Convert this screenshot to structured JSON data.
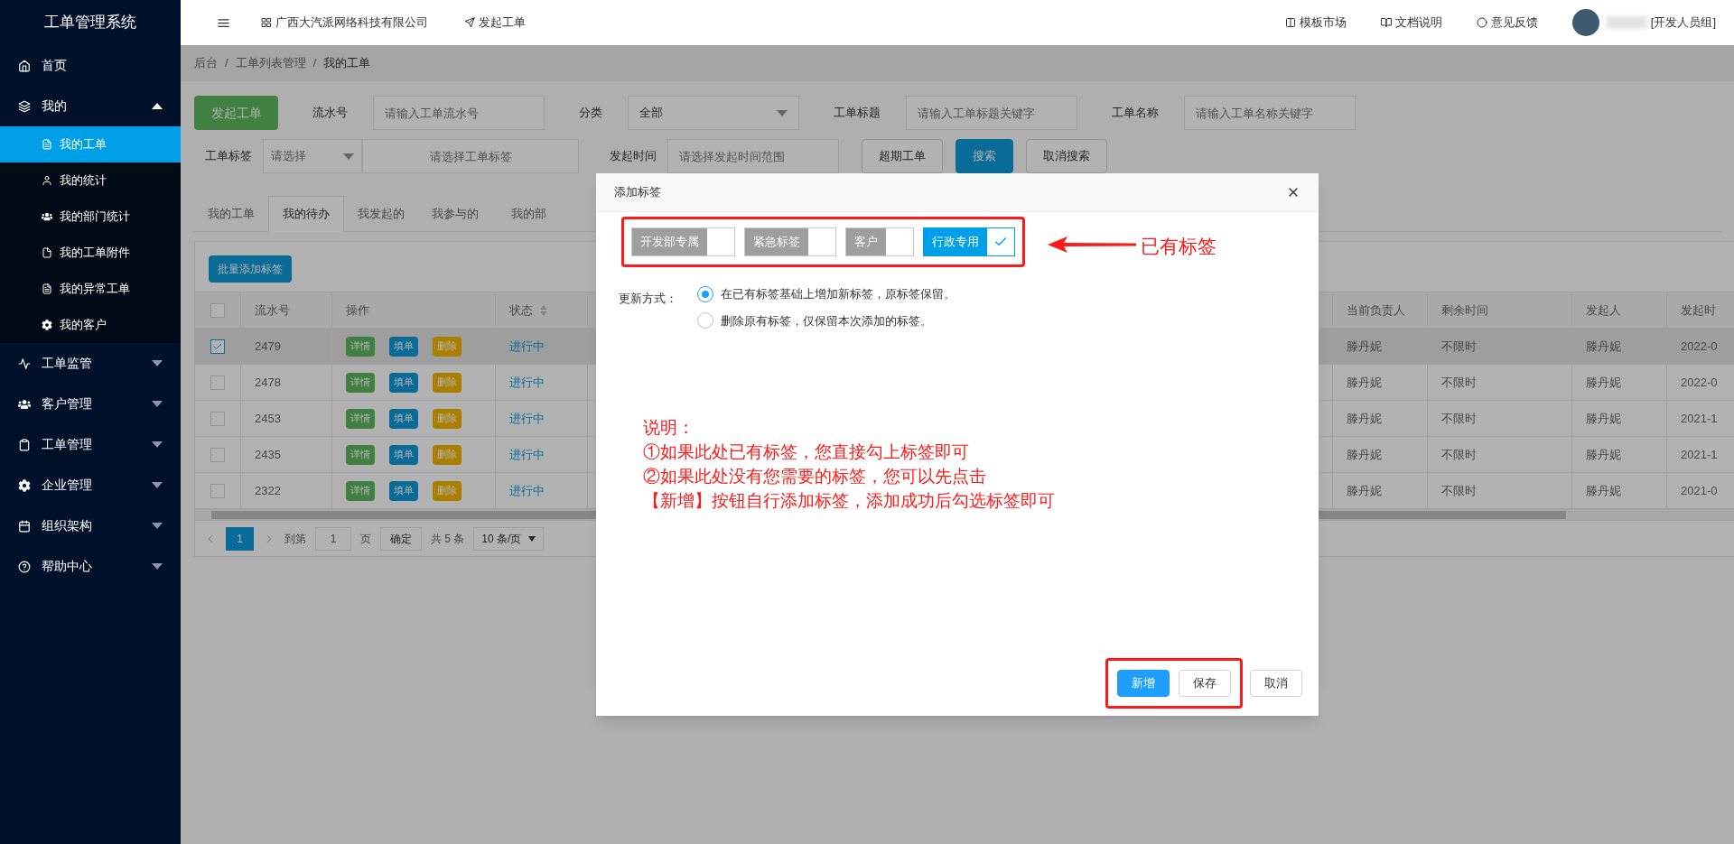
{
  "sidebar": {
    "title": "工单管理系统",
    "items": [
      {
        "label": "首页",
        "kind": "link"
      },
      {
        "label": "我的",
        "kind": "group",
        "expanded": true,
        "children": [
          {
            "label": "我的工单",
            "selected": true
          },
          {
            "label": "我的统计",
            "selected": false
          },
          {
            "label": "我的部门统计",
            "selected": false
          },
          {
            "label": "我的工单附件",
            "selected": false
          },
          {
            "label": "我的异常工单",
            "selected": false
          },
          {
            "label": "我的客户",
            "selected": false
          }
        ]
      },
      {
        "label": "工单监管",
        "kind": "group",
        "expanded": false
      },
      {
        "label": "客户管理",
        "kind": "group",
        "expanded": false
      },
      {
        "label": "工单管理",
        "kind": "group",
        "expanded": false
      },
      {
        "label": "企业管理",
        "kind": "group",
        "expanded": false
      },
      {
        "label": "组织架构",
        "kind": "group",
        "expanded": false
      },
      {
        "label": "帮助中心",
        "kind": "group",
        "expanded": false
      }
    ]
  },
  "header": {
    "company": "广西大汽派网络科技有限公司",
    "new_order": "发起工单",
    "links": [
      "模板市场",
      "文档说明",
      "意见反馈"
    ],
    "user": "[开发人员组]"
  },
  "breadcrumb": [
    {
      "label": "后台",
      "separator": "/"
    },
    {
      "label": "工单列表管理",
      "separator": "/"
    },
    {
      "label": "我的工单"
    }
  ],
  "filters": {
    "new_button": "发起工单",
    "row_1": [
      {
        "label": "流水号",
        "kind": "input",
        "placeholder": "请输入工单流水号"
      },
      {
        "label": "分类",
        "kind": "select",
        "value": "全部"
      },
      {
        "label": "工单标题",
        "kind": "input",
        "placeholder": "请输入工单标题关键字"
      },
      {
        "label": "工单名称",
        "kind": "input",
        "placeholder": "请输入工单名称关键字"
      }
    ],
    "row_2": [
      {
        "label": "工单标签",
        "kind": "tag",
        "select_placeholder": "请选择",
        "placeholder": "请选择工单标签"
      },
      {
        "label": "发起时间",
        "kind": "input",
        "placeholder": "请选择发起时间范围"
      }
    ],
    "buttons": [
      {
        "label": "超期工单",
        "kind": "default"
      },
      {
        "label": "搜索",
        "kind": "primary"
      },
      {
        "label": "取消搜索",
        "kind": "default"
      }
    ]
  },
  "tabs": [
    {
      "label": "我的工单",
      "selected": false
    },
    {
      "label": "我的待办",
      "selected": true
    },
    {
      "label": "我发起的",
      "selected": false
    },
    {
      "label": "我参与的",
      "selected": false
    },
    {
      "label": "我的部",
      "selected": false
    }
  ],
  "table": {
    "batch_button": "批量添加标签",
    "all_checked": false,
    "columns": [
      {
        "label": "流水号",
        "sortable": false
      },
      {
        "label": "操作",
        "sortable": false
      },
      {
        "label": "状态",
        "sortable": true
      },
      {
        "label": "当前负责人",
        "sortable": false
      },
      {
        "label": "剩余时间",
        "sortable": false
      },
      {
        "label": "发起人",
        "sortable": false
      },
      {
        "label": "发起时",
        "sortable": false
      }
    ],
    "rows": [
      {
        "checked": true,
        "id": "2479",
        "actions": [
          {
            "label": "详情",
            "kind": "info"
          },
          {
            "label": "填单",
            "kind": "primary"
          },
          {
            "label": "删除",
            "kind": "warning"
          }
        ],
        "status": "进行中",
        "owner": "滕丹妮",
        "remaining": "不限时",
        "creator": "滕丹妮",
        "created": "2022-0"
      },
      {
        "checked": false,
        "id": "2478",
        "actions": [
          {
            "label": "详情",
            "kind": "info"
          },
          {
            "label": "填单",
            "kind": "primary"
          },
          {
            "label": "删除",
            "kind": "warning"
          }
        ],
        "status": "进行中",
        "owner": "滕丹妮",
        "remaining": "不限时",
        "creator": "滕丹妮",
        "created": "2022-0"
      },
      {
        "checked": false,
        "id": "2453",
        "actions": [
          {
            "label": "详情",
            "kind": "info"
          },
          {
            "label": "填单",
            "kind": "primary"
          },
          {
            "label": "删除",
            "kind": "warning"
          }
        ],
        "status": "进行中",
        "owner": "滕丹妮",
        "remaining": "不限时",
        "creator": "滕丹妮",
        "created": "2021-1"
      },
      {
        "checked": false,
        "id": "2435",
        "actions": [
          {
            "label": "详情",
            "kind": "info"
          },
          {
            "label": "填单",
            "kind": "primary"
          },
          {
            "label": "删除",
            "kind": "warning"
          }
        ],
        "status": "进行中",
        "owner": "滕丹妮",
        "remaining": "不限时",
        "creator": "滕丹妮",
        "created": "2021-1"
      },
      {
        "checked": false,
        "id": "2322",
        "actions": [
          {
            "label": "详情",
            "kind": "info"
          },
          {
            "label": "填单",
            "kind": "primary"
          },
          {
            "label": "删除",
            "kind": "warning"
          }
        ],
        "status": "进行中",
        "owner": "滕丹妮",
        "remaining": "不限时",
        "creator": "滕丹妮",
        "created": "2021-0"
      }
    ]
  },
  "pagination": {
    "current": "1",
    "goto_label": "到第",
    "goto_value": "1",
    "page_unit": "页",
    "confirm": "确定",
    "total": "共 5 条",
    "page_size": "10 条/页"
  },
  "dialog": {
    "title": "添加标签",
    "tags": [
      {
        "label": "开发部专属",
        "checked": false
      },
      {
        "label": "紧急标签",
        "checked": false
      },
      {
        "label": "客户",
        "checked": false
      },
      {
        "label": "行政专用",
        "checked": true
      }
    ],
    "update_label": "更新方式：",
    "options": [
      {
        "label": "在已有标签基础上增加新标签，原标签保留。",
        "selected": true
      },
      {
        "label": "删除原有标签，仅保留本次添加的标签。",
        "selected": false
      }
    ],
    "note": [
      "说明：",
      "①如果此处已有标签，您直接勾上标签即可",
      "②如果此处没有您需要的标签，您可以先点击",
      "【新增】按钮自行添加标签，添加成功后勾选标签即可"
    ],
    "buttons": [
      {
        "label": "新增",
        "kind": "primary",
        "highlighted": true
      },
      {
        "label": "保存",
        "kind": "default",
        "highlighted": true
      },
      {
        "label": "取消",
        "kind": "default",
        "highlighted": false
      }
    ]
  },
  "annotation": {
    "callout": "已有标签"
  }
}
